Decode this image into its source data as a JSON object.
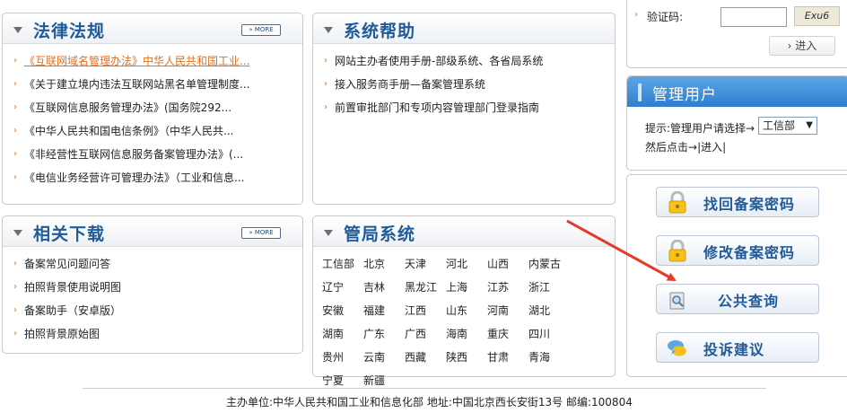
{
  "laws": {
    "title": "法律法规",
    "more": "MORE",
    "items": [
      "《互联网域名管理办法》中华人民共和国工业...",
      "《关于建立境内违法互联网站黑名单管理制度...",
      "《互联网信息服务管理办法》(国务院292...",
      "《中华人民共和国电信条例》（中华人民共...",
      "《非经营性互联网信息服务备案管理办法》(...",
      "《电信业务经营许可管理办法》（工业和信息..."
    ]
  },
  "help": {
    "title": "系统帮助",
    "items": [
      "网站主办者使用手册-部级系统、各省局系统",
      "接入服务商手册—备案管理系统",
      "前置审批部门和专项内容管理部门登录指南"
    ]
  },
  "downloads": {
    "title": "相关下载",
    "more": "MORE",
    "items": [
      "备案常见问题问答",
      "拍照背景使用说明图",
      "备案助手（安卓版）",
      "拍照背景原始图"
    ]
  },
  "bureau": {
    "title": "管局系统",
    "provinces": [
      "工信部",
      "北京",
      "天津",
      "河北",
      "山西",
      "内蒙古",
      "辽宁",
      "吉林",
      "黑龙江",
      "上海",
      "江苏",
      "浙江",
      "安徽",
      "福建",
      "江西",
      "山东",
      "河南",
      "湖北",
      "湖南",
      "广东",
      "广西",
      "海南",
      "重庆",
      "四川",
      "贵州",
      "云南",
      "西藏",
      "陕西",
      "甘肃",
      "青海",
      "宁夏",
      "新疆"
    ]
  },
  "login": {
    "captcha_label": "验证码:",
    "captcha_text": "Exu6",
    "submit": "进入"
  },
  "admin": {
    "title": "管理用户",
    "hint": "提示:管理用户请选择→",
    "selected": "工信部",
    "then_prefix": "然后点击→",
    "then_link": "|进入|"
  },
  "actions": {
    "retrieve": "找回备案密码",
    "modify": "修改备案密码",
    "query": "公共查询",
    "complaint": "投诉建议"
  },
  "footer": "主办单位:中华人民共和国工业和信息化部 地址:中国北京西长安街13号 邮编:100804",
  "colors": {
    "title_blue": "#1f5a99",
    "orange": "#e4711f",
    "arrow_red": "#e53a2a",
    "header_blue": "#2f7ecf"
  }
}
